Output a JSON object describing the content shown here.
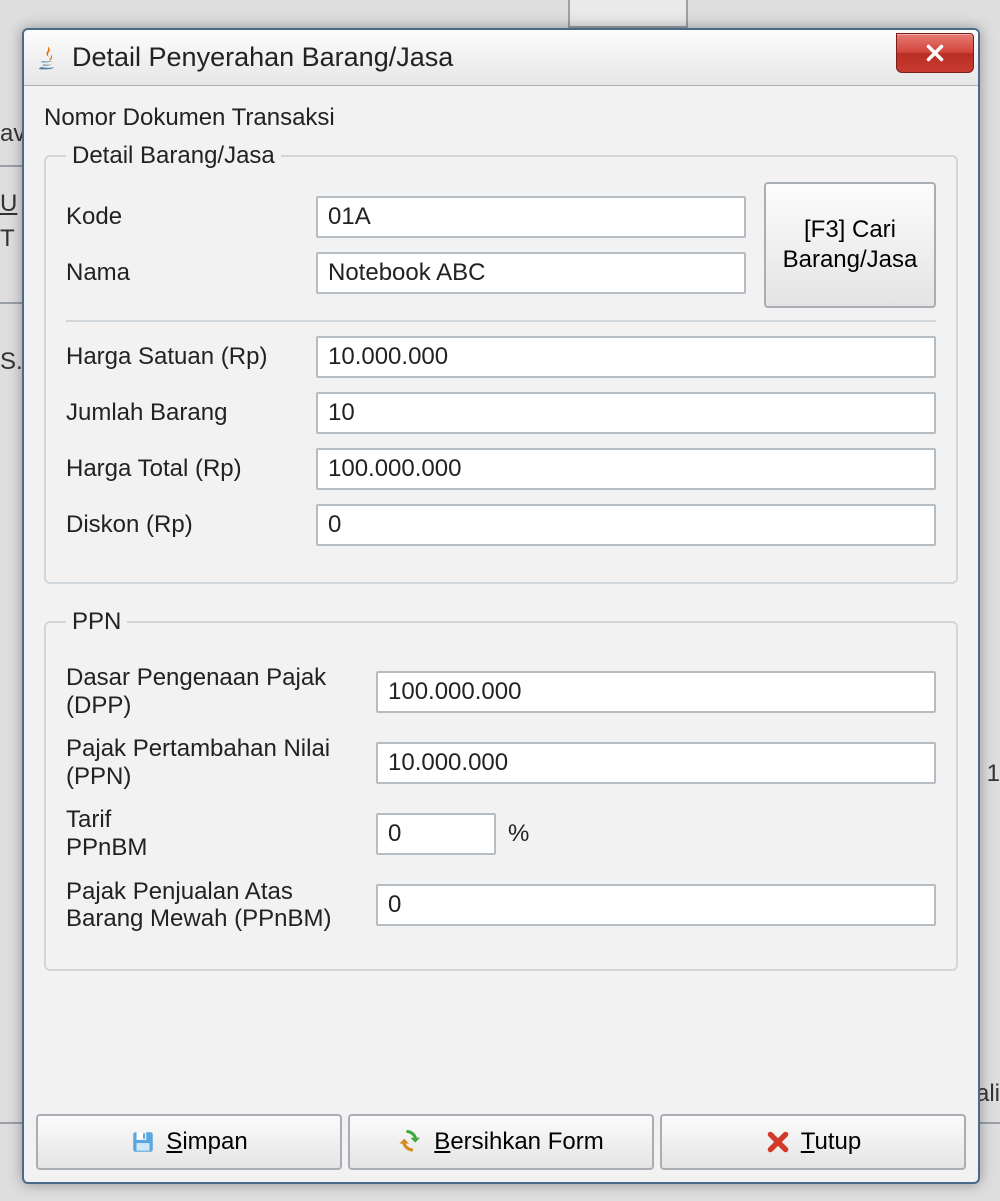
{
  "window": {
    "title": "Detail Penyerahan Barang/Jasa"
  },
  "header_label": "Nomor Dokumen Transaksi",
  "detail": {
    "legend": "Detail Barang/Jasa",
    "kode_label": "Kode",
    "kode_value": "01A",
    "nama_label": "Nama",
    "nama_value": "Notebook ABC",
    "cari_button": "[F3] Cari\nBarang/Jasa",
    "harga_satuan_label": "Harga Satuan (Rp)",
    "harga_satuan_value": "10.000.000",
    "jumlah_label": "Jumlah Barang",
    "jumlah_value": "10",
    "harga_total_label": "Harga Total (Rp)",
    "harga_total_value": "100.000.000",
    "diskon_label": "Diskon (Rp)",
    "diskon_value": "0"
  },
  "ppn": {
    "legend": "PPN",
    "dpp_label": "Dasar Pengenaan Pajak (DPP)",
    "dpp_value": "100.000.000",
    "ppn_label": "Pajak Pertambahan Nilai (PPN)",
    "ppn_value": "10.000.000",
    "tarif_label": "Tarif\nPPnBM",
    "tarif_value": "0",
    "tarif_suffix": "%",
    "ppnbm_label": "Pajak Penjualan Atas Barang Mewah (PPnBM)",
    "ppnbm_value": "0"
  },
  "buttons": {
    "simpan_prefix": "",
    "simpan_u": "S",
    "simpan_suffix": "impan",
    "bersihkan_prefix": "",
    "bersihkan_u": "B",
    "bersihkan_suffix": "ersihkan Form",
    "tutup_prefix": "",
    "tutup_u": "T",
    "tutup_suffix": "utup"
  },
  "background": {
    "av": "av",
    "u": "U",
    "t": "T",
    "s": "S..",
    "one": "1",
    "li": "ali"
  }
}
